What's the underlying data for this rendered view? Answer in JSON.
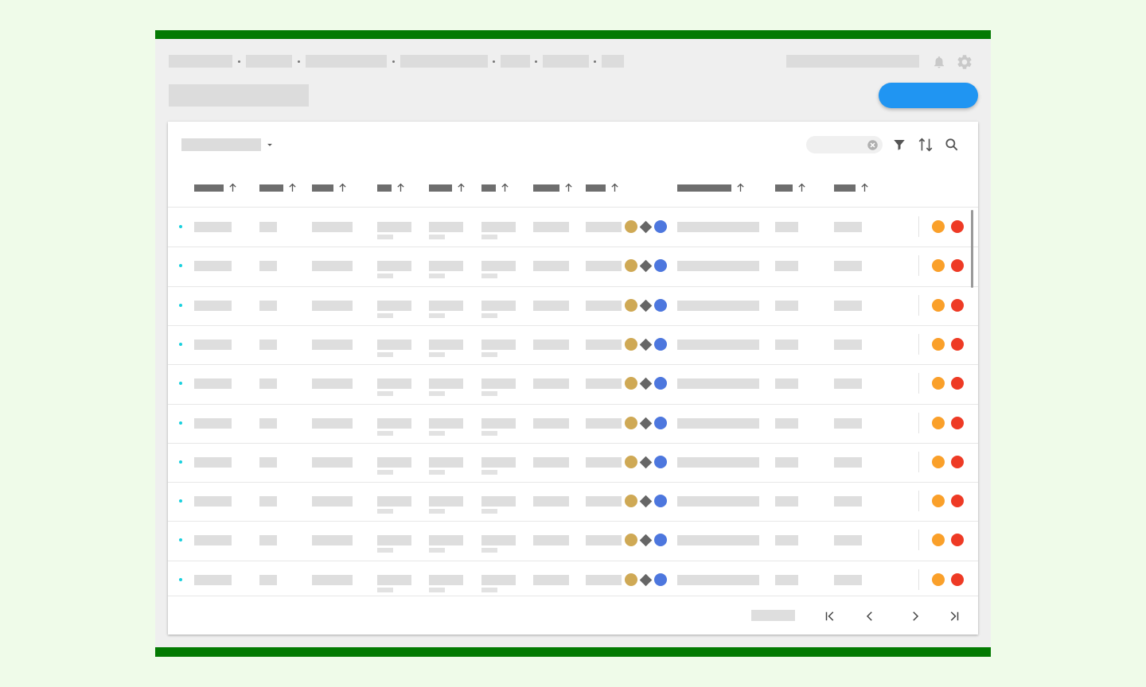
{
  "colors": {
    "page_background": "#effbe9",
    "frame_bar": "#037a02",
    "primary_button": "#2095f2",
    "row_bullet": "#19d0de",
    "symbol_gold": "#cfa955",
    "symbol_gray": "#666666",
    "symbol_blue": "#4d77de",
    "status_orange": "#faa02a",
    "status_red": "#ee3a25"
  },
  "header": {
    "breadcrumb_separator_count": 6,
    "icons": [
      "bell-icon",
      "gear-icon"
    ],
    "primary_button": {
      "label": ""
    }
  },
  "toolbar": {
    "view_select_icon": "caret-down-icon",
    "search_value": "",
    "icons": [
      "clear-icon",
      "filter-icon",
      "sort-icon",
      "search-icon"
    ]
  },
  "table": {
    "header_sort_icon": "arrow-up-icon",
    "column_count": 11,
    "row_count": 10,
    "row_symbols": [
      "circle",
      "diamond",
      "circle"
    ],
    "row_status": [
      "orange",
      "red"
    ]
  },
  "pagination": {
    "icons": [
      "first-page-icon",
      "prev-page-icon",
      "next-page-icon",
      "last-page-icon"
    ]
  }
}
